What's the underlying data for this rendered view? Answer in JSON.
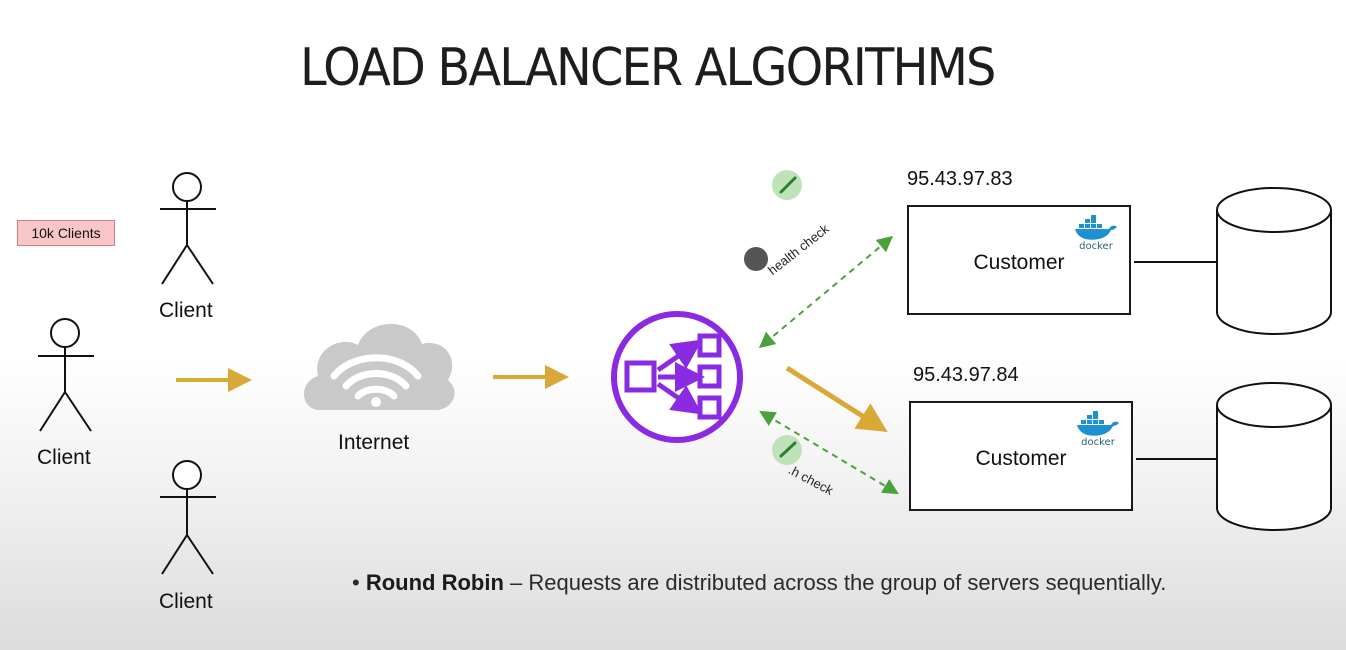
{
  "title": "LOAD BALANCER ALGORITHMS",
  "badge": "10k Clients",
  "clients": {
    "top_label": "Client",
    "middle_label": "Client",
    "bottom_label": "Client"
  },
  "internet": {
    "label": "Internet"
  },
  "health_check": {
    "top_label": "health check",
    "bottom_label": ".h check"
  },
  "servers": [
    {
      "ip": "95.43.97.83",
      "name": "Customer",
      "logo_text": "docker"
    },
    {
      "ip": "95.43.97.84",
      "name": "Customer",
      "logo_text": "docker"
    }
  ],
  "bullet": {
    "term": "Round Robin",
    "dash": " – ",
    "description": "Requests are distributed across the group of servers sequentially."
  },
  "colors": {
    "arrow": "#d9a937",
    "load_balancer": "#8a2be2",
    "health_check": "#4aa23a",
    "badge_bg": "#f8c6c8",
    "cloud": "#c9c9c9"
  },
  "icons": [
    "stick-figure-icon",
    "cloud-wifi-icon",
    "load-balancer-icon",
    "docker-whale-icon",
    "database-cylinder-icon",
    "check-dot-icon"
  ]
}
